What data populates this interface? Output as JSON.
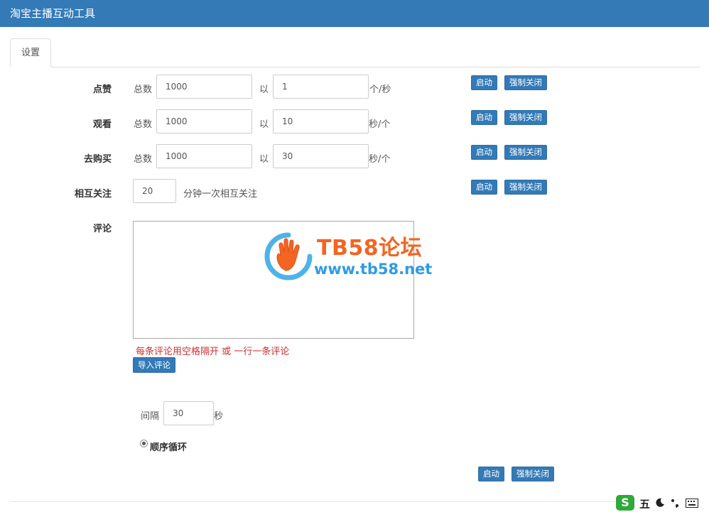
{
  "app": {
    "title": "淘宝主播互动工具"
  },
  "tabs": [
    {
      "label": "设置"
    }
  ],
  "rows": {
    "like": {
      "label": "点赞",
      "total_label": "总数",
      "total_value": "1000",
      "rate_prefix": "以",
      "rate_value": "1",
      "unit": "个/秒",
      "start_label": "启动",
      "stop_label": "强制关闭"
    },
    "watch": {
      "label": "观看",
      "total_label": "总数",
      "total_value": "1000",
      "rate_prefix": "以",
      "rate_value": "10",
      "unit": "秒/个",
      "start_label": "启动",
      "stop_label": "强制关闭"
    },
    "buy": {
      "label": "去购买",
      "total_label": "总数",
      "total_value": "1000",
      "rate_prefix": "以",
      "rate_value": "30",
      "unit": "秒/个",
      "start_label": "启动",
      "stop_label": "强制关闭"
    },
    "follow": {
      "label": "相互关注",
      "interval_value": "20",
      "unit": "分钟一次相互关注",
      "start_label": "启动",
      "stop_label": "强制关闭"
    }
  },
  "comments": {
    "label": "评论",
    "text_value": "",
    "hint": "每条评论用空格隔开 或 一行一条评论",
    "import_label": "导入评论",
    "interval_label": "间隔",
    "interval_value": "30",
    "interval_unit": "秒",
    "mode_label": "顺序循环",
    "mode_selected": true,
    "start_label": "启动",
    "stop_label": "强制关闭"
  },
  "watermark": {
    "line1": "TB58论坛",
    "line2": "www.tb58.net"
  },
  "taskbar": {
    "ime_logo": "S",
    "ime_mode": "五",
    "icons": [
      "moon-icon",
      "punctuation-icon",
      "keyboard-icon"
    ]
  },
  "colors": {
    "header": "#337ab7",
    "button": "#337ab7",
    "hint": "#c9302c"
  }
}
